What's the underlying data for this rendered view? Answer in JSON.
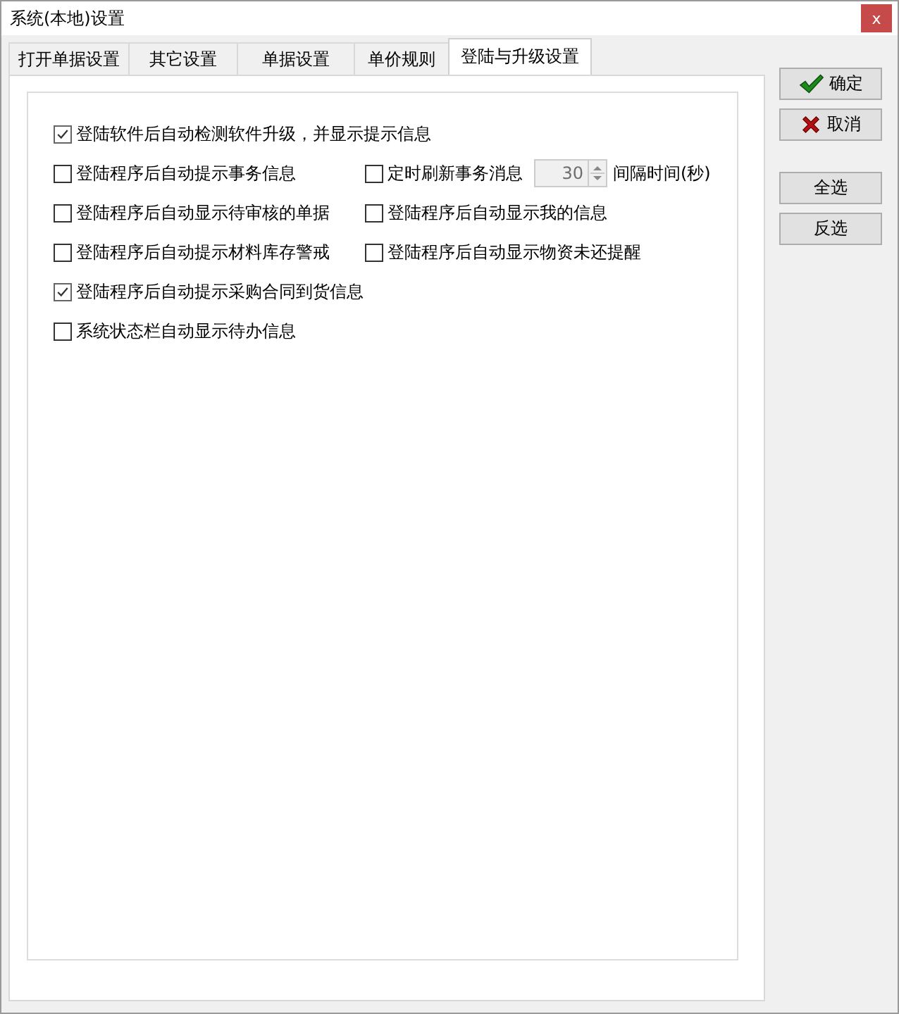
{
  "window": {
    "title": "系统(本地)设置",
    "close": "x"
  },
  "tabs": [
    {
      "label": "打开单据设置",
      "selected": false
    },
    {
      "label": "其它设置",
      "selected": false
    },
    {
      "label": "单据设置",
      "selected": false
    },
    {
      "label": "单价规则",
      "selected": false
    },
    {
      "label": "登陆与升级设置",
      "selected": true
    }
  ],
  "rows": [
    {
      "items": [
        {
          "label": "登陆软件后自动检测软件升级，并显示提示信息",
          "checked": true
        }
      ]
    },
    {
      "items": [
        {
          "label": "登陆程序后自动提示事务信息",
          "checked": false
        },
        {
          "label": "定时刷新事务消息",
          "checked": false,
          "spinner": {
            "value": "30",
            "disabled": true
          },
          "suffix": "间隔时间(秒)"
        }
      ]
    },
    {
      "items": [
        {
          "label": "登陆程序后自动显示待审核的单据",
          "checked": false
        },
        {
          "label": "登陆程序后自动显示我的信息",
          "checked": false
        }
      ]
    },
    {
      "items": [
        {
          "label": "登陆程序后自动提示材料库存警戒",
          "checked": false
        },
        {
          "label": "登陆程序后自动显示物资未还提醒",
          "checked": false
        }
      ]
    },
    {
      "items": [
        {
          "label": "登陆程序后自动提示采购合同到货信息",
          "checked": true
        }
      ]
    },
    {
      "items": [
        {
          "label": "系统状态栏自动显示待办信息",
          "checked": false
        }
      ]
    }
  ],
  "buttons": [
    {
      "label": "确定",
      "kind": "confirm"
    },
    {
      "label": "取消",
      "kind": "cancel"
    },
    {
      "label": "全选",
      "kind": "plain"
    },
    {
      "label": "反选",
      "kind": "plain"
    }
  ]
}
